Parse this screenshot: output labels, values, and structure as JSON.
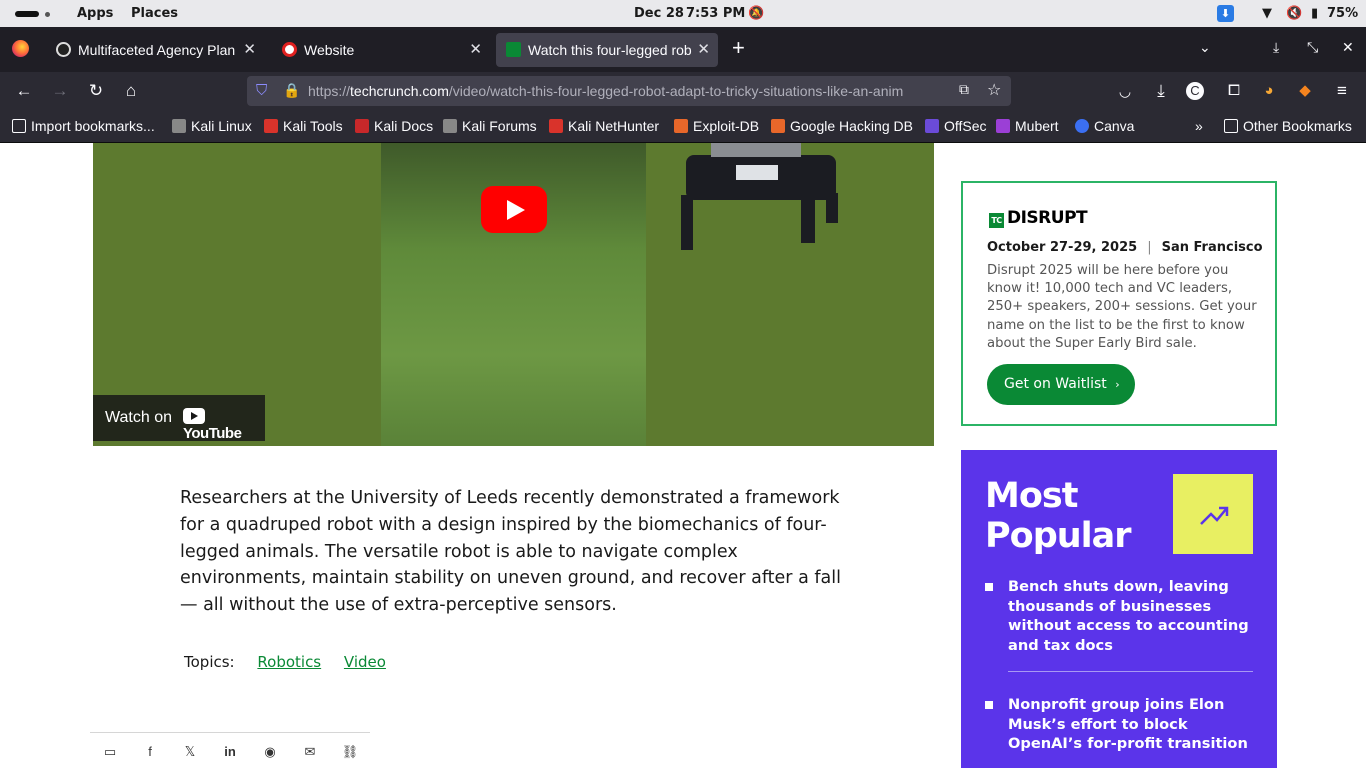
{
  "os": {
    "apps": "Apps",
    "places": "Places",
    "date": "Dec 28",
    "time": "7:53 PM",
    "battery": "75%"
  },
  "tabs": [
    {
      "label": "Multifaceted Agency Plan",
      "active": false
    },
    {
      "label": "Website",
      "active": false
    },
    {
      "label": "Watch this four-legged rob",
      "active": true
    }
  ],
  "url": {
    "prefix": "https://",
    "host": "techcrunch.com",
    "path": "/video/watch-this-four-legged-robot-adapt-to-tricky-situations-like-an-anim"
  },
  "bookmarks": [
    {
      "label": "Import bookmarks...",
      "icon": "import-icon"
    },
    {
      "label": "Kali Linux",
      "icon": "kali-dragon-icon"
    },
    {
      "label": "Kali Tools",
      "icon": "kali-tools-icon"
    },
    {
      "label": "Kali Docs",
      "icon": "kali-docs-icon"
    },
    {
      "label": "Kali Forums",
      "icon": "kali-forums-icon"
    },
    {
      "label": "Kali NetHunter",
      "icon": "kali-nethunter-icon"
    },
    {
      "label": "Exploit-DB",
      "icon": "exploit-db-icon"
    },
    {
      "label": "Google Hacking DB",
      "icon": "ghdb-icon"
    },
    {
      "label": "OffSec",
      "icon": "offsec-icon"
    },
    {
      "label": "Mubert",
      "icon": "mubert-icon"
    },
    {
      "label": "Canva",
      "icon": "canva-icon"
    },
    {
      "label": "Other Bookmarks",
      "icon": "folder-icon"
    }
  ],
  "video": {
    "watch_on": "Watch on",
    "youtube": "YouTube"
  },
  "article": {
    "body": "Researchers at the University of Leeds recently demonstrated a framework for a quadruped robot with a design inspired by the biomechanics of four-legged animals. The versatile robot is able to navigate complex environments, maintain stability on uneven ground, and recover after a fall — all without the use of extra-perceptive sensors.",
    "topics_label": "Topics:",
    "topics": [
      "Robotics",
      "Video"
    ]
  },
  "disrupt": {
    "logo_text": "DISRUPT",
    "dates": "October 27-29, 2025",
    "location": "San Francisco",
    "description": "Disrupt 2025 will be here before you know it! 10,000 tech and VC leaders, 250+ speakers, 200+ sessions. Get your name on the list to be the first to know about the Super Early Bird sale.",
    "button": "Get on Waitlist"
  },
  "popular": {
    "title_line1": "Most",
    "title_line2": "Popular",
    "items": [
      "Bench shuts down, leaving thousands of businesses without access to accounting and tax docs",
      "Nonprofit group joins Elon Musk’s effort to block OpenAI’s for-profit transition"
    ]
  },
  "colors": {
    "accent_green": "#0a8935",
    "popular_purple": "#5b34ea",
    "trend_yellow": "#e8ef62",
    "youtube_red": "#ff0000"
  }
}
